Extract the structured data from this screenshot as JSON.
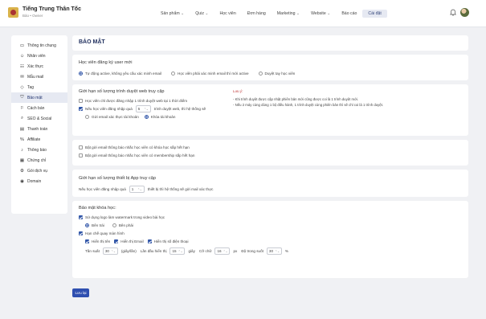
{
  "brand": {
    "name": "Tiếng Trung Thân Tốc",
    "role": "Bảo • Owner"
  },
  "nav": [
    {
      "label": "Sản phẩm",
      "caret": true
    },
    {
      "label": "Quiz",
      "caret": true
    },
    {
      "label": "Học viên",
      "caret": false
    },
    {
      "label": "Đơn hàng",
      "caret": false
    },
    {
      "label": "Marketing",
      "caret": true
    },
    {
      "label": "Website",
      "caret": true
    },
    {
      "label": "Báo cáo",
      "caret": false
    },
    {
      "label": "Cài đặt",
      "caret": false,
      "active": true
    }
  ],
  "sidebar": [
    {
      "icon": "monitor-icon",
      "glyph": "▭",
      "label": "Thông tin chung"
    },
    {
      "icon": "users-icon",
      "glyph": "☺",
      "label": "Nhân viên"
    },
    {
      "icon": "verify-icon",
      "glyph": "☷",
      "label": "Xác thực"
    },
    {
      "icon": "mail-icon",
      "glyph": "✉",
      "label": "Mẫu mail"
    },
    {
      "icon": "tag-icon",
      "glyph": "◇",
      "label": "Tag"
    },
    {
      "icon": "shield-icon",
      "glyph": "⛉",
      "label": "Bảo mật",
      "active": true
    },
    {
      "icon": "cart-icon",
      "glyph": "⚐",
      "label": "Cách bán"
    },
    {
      "icon": "seo-icon",
      "glyph": "⌕",
      "label": "SEO & Social"
    },
    {
      "icon": "payment-icon",
      "glyph": "▤",
      "label": "Thanh toán"
    },
    {
      "icon": "percent-icon",
      "glyph": "%",
      "label": "Affiliate"
    },
    {
      "icon": "bell-icon",
      "glyph": "♪",
      "label": "Thông báo"
    },
    {
      "icon": "certificate-icon",
      "glyph": "▦",
      "label": "Chứng chỉ"
    },
    {
      "icon": "package-icon",
      "glyph": "⚙",
      "label": "Gói dịch vụ"
    },
    {
      "icon": "globe-icon",
      "glyph": "◉",
      "label": "Domain"
    }
  ],
  "page": {
    "title": "BẢO MẬT"
  },
  "register": {
    "title": "Học viên đăng ký user mới",
    "options": [
      "Tự động active, không yêu cầu xác minh email",
      "Học viên phải xác minh email thì mới active",
      "Duyệt tay học viên"
    ],
    "selected": 0
  },
  "browser_limit": {
    "title": "Giới hạn số lượng trình duyệt web truy cập",
    "opt1": "Học viên chỉ được đăng nhập 1 trình duyệt web tại 1 thời điểm",
    "opt2_prefix": "Nếu học viên đăng nhập quá",
    "opt2_value": "5",
    "opt2_suffix": "trình duyệt web, thì hệ thống sẽ",
    "action_a": "Gửi email xác thực tài khoản",
    "action_b": "Khóa tài khoản",
    "note_title": "Lưu ý:",
    "note1": "- Khi trình duyệt được cập nhật phiên bản mới cũng được coi là 1 trình duyệt mới.",
    "note2": "- Nếu 2 máy cùng dùng 1 bộ điều hành, 1 trình duyệt cùng phiên bản thì sẽ chỉ coi là 1 trình duyệt."
  },
  "expiry": {
    "opt1": "Bật gửi email thông báo nhắc học viên có khóa học sắp hết hạn",
    "opt2": "Bật gửi email thông báo nhắc học viên có membership sắp hết hạn"
  },
  "app_limit": {
    "title": "Giới hạn số lượng thiết bị App truy cập",
    "prefix": "Nếu học viên đăng nhập quá",
    "value": "1",
    "suffix": "thiết bị thì hệ thống sẽ gửi mail xác thực"
  },
  "course_security": {
    "title": "Bảo mật khóa học:",
    "watermark": "Sử dụng logo làm watermark trong video bài học",
    "pos_left": "Bên trái",
    "pos_right": "Bên phải",
    "screen_rec": "Hạn chế quay màn hình",
    "show_name": "Hiển thị tên",
    "show_email": "Hiển thị Email",
    "show_phone": "Hiển thị số điện thoại",
    "freq_label": "Tần suất",
    "freq_value": "30",
    "freq_unit": "(giây/lần)",
    "first_label": "Lần đầu hiển thị",
    "first_value": "15",
    "first_unit": "giây",
    "size_label": "Cỡ chữ",
    "size_value": "16",
    "size_unit": "px",
    "opacity_label": "Độ trong suốt",
    "opacity_value": "30",
    "opacity_unit": "%"
  },
  "save_label": "Lưu lại"
}
